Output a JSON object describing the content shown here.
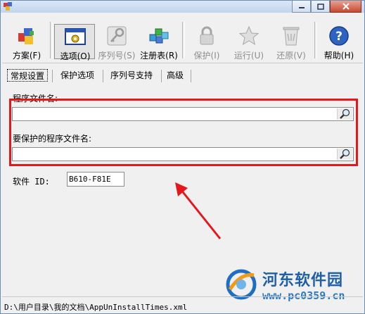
{
  "toolbar": {
    "buttons": [
      {
        "label": "方案(F)",
        "icon": "scheme-icon",
        "enabled": true,
        "active": false
      },
      {
        "label": "选项(O)",
        "icon": "options-icon",
        "enabled": true,
        "active": true
      },
      {
        "label": "序列号(S)",
        "icon": "key-icon",
        "enabled": false,
        "active": false
      },
      {
        "label": "注册表(R)",
        "icon": "registry-icon",
        "enabled": true,
        "active": false
      },
      {
        "label": "保护(I)",
        "icon": "lock-icon",
        "enabled": false,
        "active": false
      },
      {
        "label": "运行(U)",
        "icon": "star-icon",
        "enabled": false,
        "active": false
      },
      {
        "label": "还原(V)",
        "icon": "recycle-bin-icon",
        "enabled": false,
        "active": false
      },
      {
        "label": "帮助(H)",
        "icon": "help-icon",
        "enabled": true,
        "active": false
      }
    ]
  },
  "tabs": [
    {
      "label": "常规设置",
      "active": true
    },
    {
      "label": "保护选项",
      "active": false
    },
    {
      "label": "序列号支持",
      "active": false
    },
    {
      "label": "高级",
      "active": false
    }
  ],
  "form": {
    "program_file_label": "程序文件名:",
    "program_file_value": "",
    "protected_file_label": "要保护的程序文件名:",
    "protected_file_value": "",
    "software_id_label": "软件 ID:",
    "software_id_value": "B610-F81E"
  },
  "status": {
    "path": "D:\\用户目录\\我的文档\\AppUnInstallTimes.xml"
  },
  "watermark": {
    "title": "河东软件园",
    "url": "www.pc0359.cn"
  },
  "colors": {
    "highlight_border": "#e6171b",
    "annotation_arrow": "#e6171b",
    "watermark": "#1e5fa8"
  }
}
